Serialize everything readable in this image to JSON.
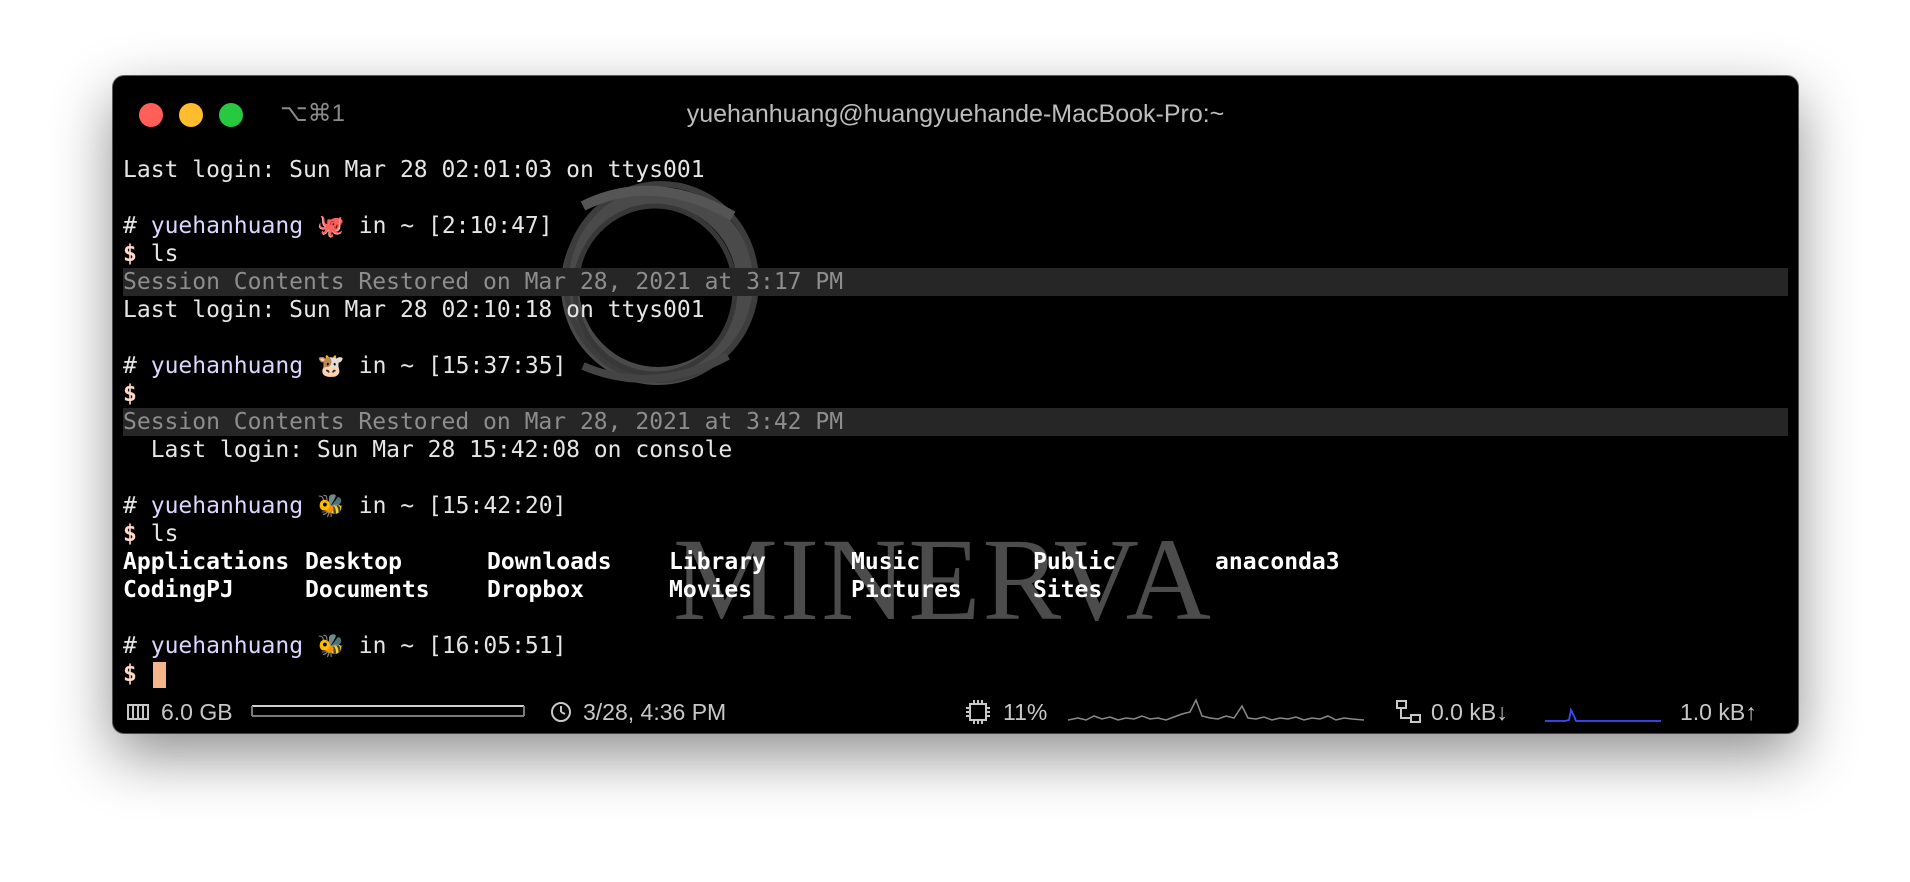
{
  "window": {
    "title": "yuehanhuang@huangyuehande-MacBook-Pro:~",
    "shortcut": "⌥⌘1"
  },
  "watermark": {
    "text": "MINERVA"
  },
  "terminal": {
    "login1": "Last login: Sun Mar 28 02:01:03 on ttys001",
    "p1": {
      "hash": "#",
      "user": "yuehanhuang",
      "emoji": "🐙",
      "rest": " in ~ [2:10:47]"
    },
    "cmd1": "ls",
    "restored1": "Session Contents Restored on Mar 28, 2021 at 3:17 PM",
    "login2": "Last login: Sun Mar 28 02:10:18 on ttys001",
    "p2": {
      "hash": "#",
      "user": "yuehanhuang",
      "emoji": "🐮",
      "rest": " in ~ [15:37:35]"
    },
    "restored2": "Session Contents Restored on Mar 28, 2021 at 3:42 PM",
    "login3": "  Last login: Sun Mar 28 15:42:08 on console",
    "p3": {
      "hash": "#",
      "user": "yuehanhuang",
      "emoji": "🐝",
      "rest": " in ~ [15:42:20]"
    },
    "cmd3": "ls",
    "ls_row1": [
      "Applications",
      "Desktop",
      "Downloads",
      "Library",
      "Music",
      "Public",
      "anaconda3"
    ],
    "ls_row2": [
      "CodingPJ",
      "Documents",
      "Dropbox",
      "Movies",
      "Pictures",
      "Sites",
      ""
    ],
    "p4": {
      "hash": "#",
      "user": "yuehanhuang",
      "emoji": "🐝",
      "rest": " in ~ [16:05:51]"
    },
    "dollar": "$"
  },
  "statusbar": {
    "memory": "6.0 GB",
    "datetime": "3/28, 4:36 PM",
    "cpu": "11%",
    "net_down": "0.0 kB↓",
    "net_up": "1.0 kB↑"
  },
  "colors": {
    "background": "#000000",
    "text": "#e6e6e6",
    "restored_bg": "#262626",
    "cursor": "#f5b48a",
    "net_graph": "#3b4cff"
  }
}
